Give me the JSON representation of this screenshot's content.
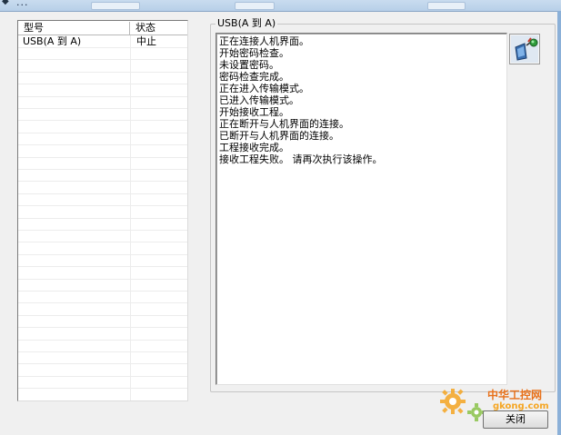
{
  "window": {
    "title": "..."
  },
  "list": {
    "headers": [
      "型号",
      "状态"
    ],
    "rows": [
      {
        "model": "USB(A 到 A)",
        "status": "中止"
      }
    ]
  },
  "group": {
    "legend": "USB(A 到 A)"
  },
  "log": {
    "lines": [
      "正在连接人机界面。",
      "开始密码检查。",
      "未设置密码。",
      "密码检查完成。",
      "正在进入传输模式。",
      "已进入传输模式。",
      "开始接收工程。",
      "正在断开与人机界面的连接。",
      "已断开与人机界面的连接。",
      "工程接收完成。",
      "接收工程失败。 请再次执行该操作。"
    ]
  },
  "buttons": {
    "close": "关闭"
  },
  "watermark": {
    "line1": "中华工控网",
    "line2": "gkong.com"
  },
  "colors": {
    "accent": "#f5a623"
  }
}
